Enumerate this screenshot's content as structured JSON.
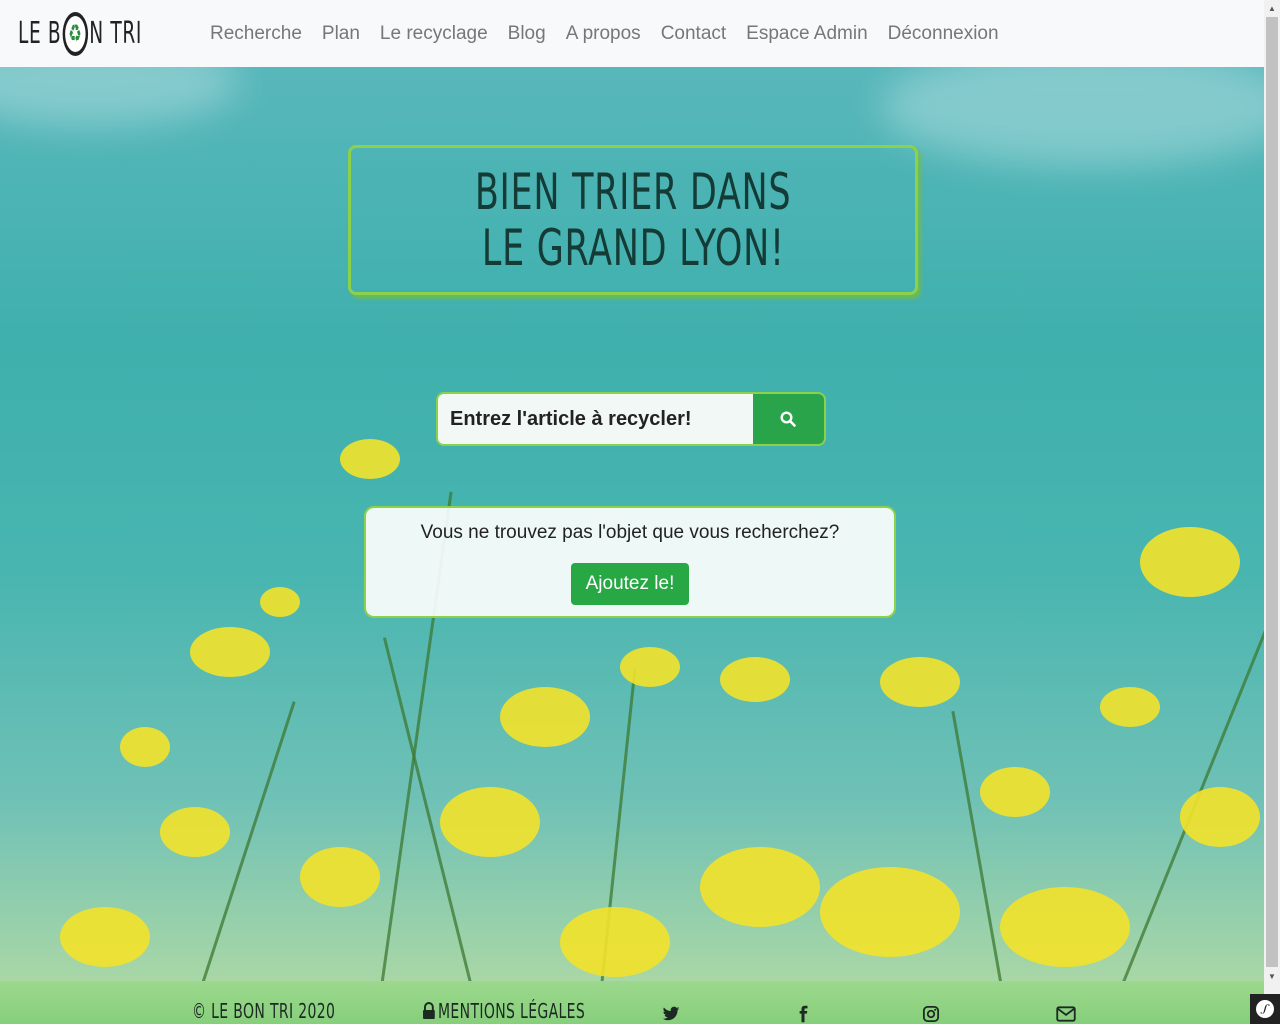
{
  "brand": {
    "prefix": "LE B",
    "suffix": "N TRI"
  },
  "nav": {
    "items": [
      "Recherche",
      "Plan",
      "Le recyclage",
      "Blog",
      "A propos",
      "Contact",
      "Espace Admin",
      "Déconnexion"
    ]
  },
  "hero": {
    "title_line1": "Bien trier dans",
    "title_line2": "le Grand Lyon!"
  },
  "search": {
    "placeholder": "Entrez l'article à recycler!",
    "button_icon": "search-icon"
  },
  "notfound": {
    "text": "Vous ne trouvez pas l'objet que vous recherchez?",
    "button_label": "Ajoutez le!"
  },
  "footer": {
    "copyright": "© Le Bon Tri 2020",
    "legal": "Mentions légales",
    "icons": [
      "twitter-icon",
      "facebook-icon",
      "instagram-icon",
      "envelope-icon"
    ]
  },
  "colors": {
    "accent_green": "#28a745",
    "border_green": "#8bd24a",
    "navbar_bg": "#f8f9fa",
    "title_text": "#143b35"
  }
}
